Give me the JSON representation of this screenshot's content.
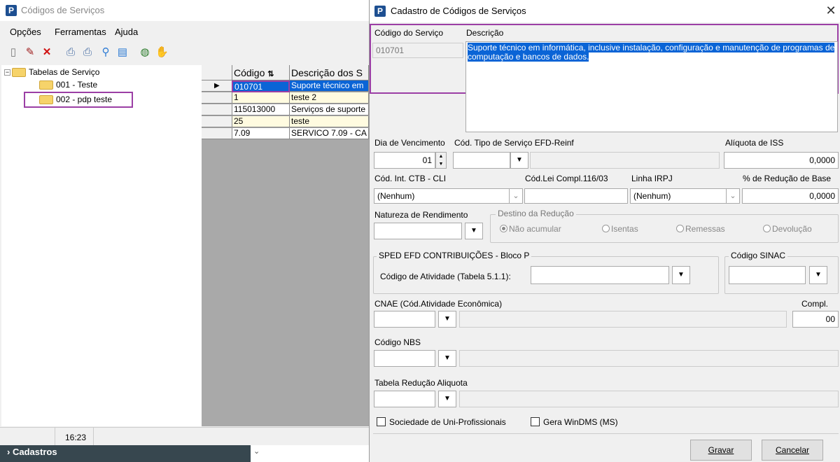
{
  "bg": {
    "title": "Códigos de Serviços",
    "menu": [
      "Opções",
      "Ferramentas",
      "Ajuda"
    ],
    "toolbar_icons": [
      "new-doc-icon",
      "edit-pencil-icon",
      "delete-x-icon",
      "print-icon",
      "print-preview-icon",
      "search-icon",
      "report-icon",
      "globe-icon",
      "hand-icon"
    ],
    "tree": {
      "root": "Tabelas de Serviço",
      "children": [
        "001 - Teste",
        "002 - pdp teste"
      ]
    },
    "grid": {
      "headers": [
        "Código",
        "Descrição dos S"
      ],
      "rows": [
        {
          "codigo": "010701",
          "desc": "Suporte técnico em"
        },
        {
          "codigo": "1",
          "desc": "teste 2"
        },
        {
          "codigo": "115013000",
          "desc": "Serviços de suporte"
        },
        {
          "codigo": "25",
          "desc": "teste"
        },
        {
          "codigo": "7.09",
          "desc": "SERVICO 7.09 - CA"
        }
      ]
    },
    "status_time": "16:23",
    "nav_label": "Cadastros"
  },
  "dialog": {
    "title": "Cadastro de Códigos de Serviços",
    "codigo_label": "Código do Serviço",
    "codigo_value": "010701",
    "descricao_label": "Descrição",
    "descricao_value": "Suporte técnico em informática, inclusive instalação, configuração e manutenção de programas de computação e bancos de dados.",
    "dia_venc_label": "Dia de Vencimento",
    "dia_venc_value": "01",
    "cod_tipo_label": "Cód. Tipo de Serviço EFD-Reinf",
    "aliquota_label": "Alíquota de ISS",
    "aliquota_value": "0,0000",
    "cod_int_label": "Cód. Int. CTB - CLI",
    "cod_int_value": "(Nenhum)",
    "cod_lei_label": "Cód.Lei Compl.116/03",
    "linha_irpj_label": "Linha IRPJ",
    "linha_irpj_value": "(Nenhum)",
    "reducao_base_label": "% de Redução de Base",
    "reducao_base_value": "0,0000",
    "natureza_label": "Natureza de Rendimento",
    "destino_label": "Destino da Redução",
    "destino_options": [
      "Não acumular",
      "Isentas",
      "Remessas",
      "Devolução"
    ],
    "destino_selected": "Não acumular",
    "sped_label": "SPED EFD CONTRIBUIÇÕES - Bloco P",
    "atividade_label": "Código de Atividade (Tabela 5.1.1):",
    "sinac_label": "Código SINAC",
    "cnae_label": "CNAE (Cód.Atividade Econômica)",
    "compl_label": "Compl.",
    "compl_value": "00",
    "nbs_label": "Código NBS",
    "tabela_reducao_label": "Tabela Redução Aliquota",
    "uni_prof_label": "Sociedade de Uni-Profissionais",
    "windms_label": "Gera WinDMS (MS)",
    "gravar_label": "Gravar",
    "cancelar_label": "Cancelar"
  },
  "highlight_color": "#9b3fa5"
}
